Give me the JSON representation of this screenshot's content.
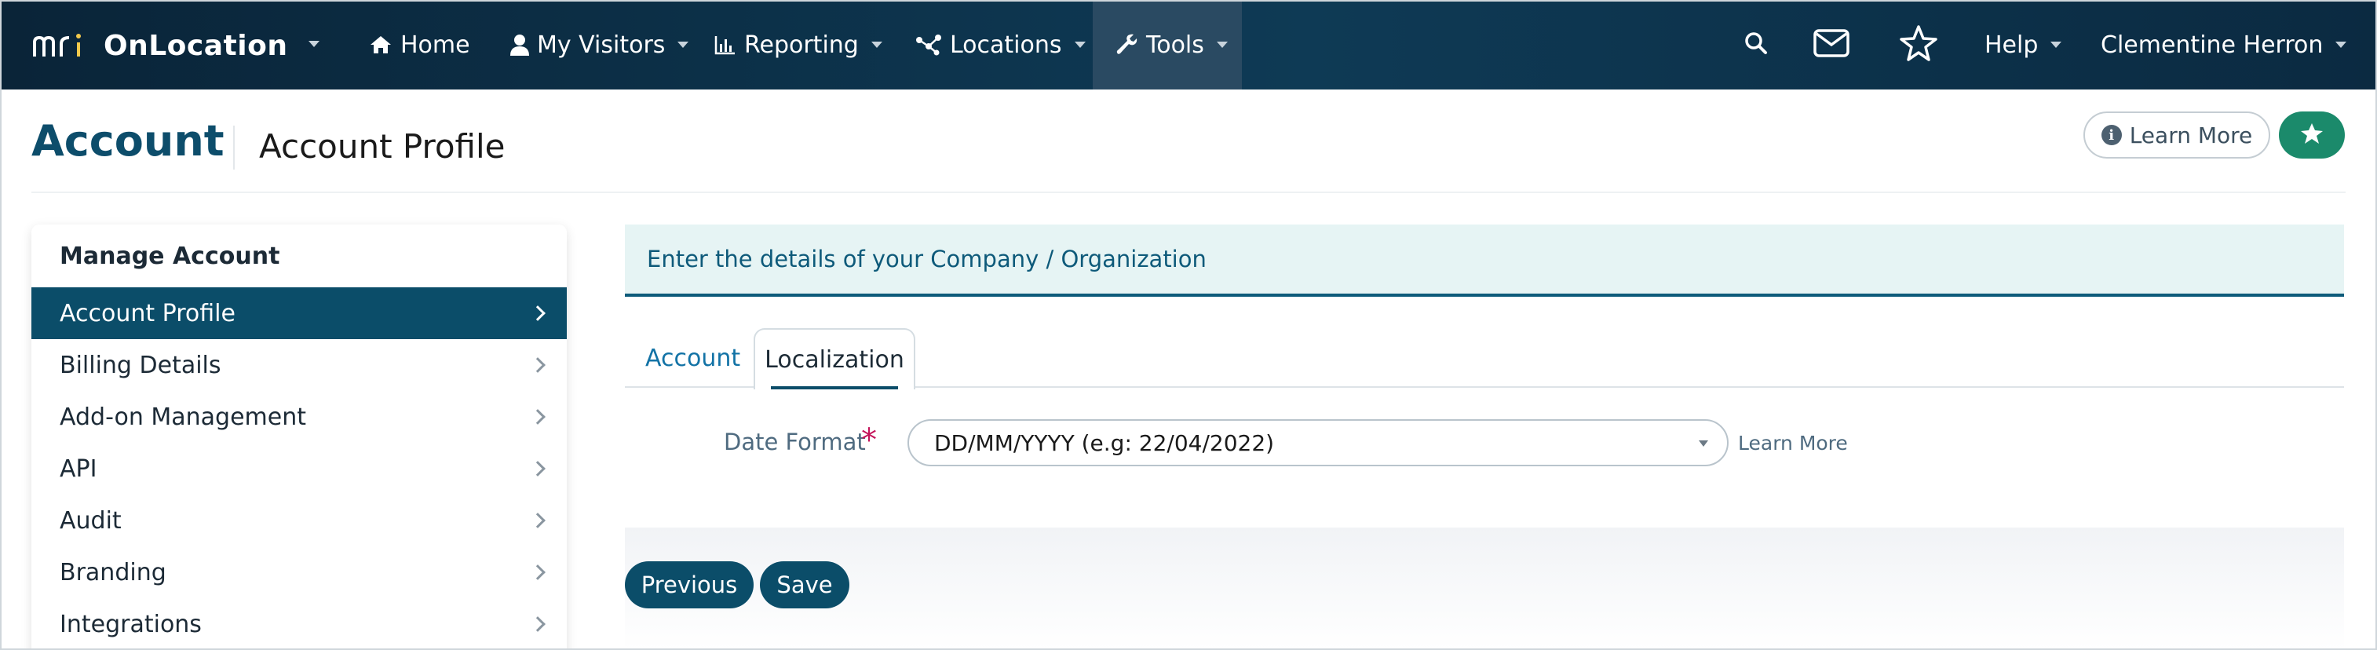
{
  "app": {
    "brand_mark": "mri",
    "brand_name": "OnLocation"
  },
  "nav": {
    "items": [
      {
        "label": "Home",
        "icon": "home-icon"
      },
      {
        "label": "My Visitors",
        "icon": "user-icon"
      },
      {
        "label": "Reporting",
        "icon": "bar-chart-icon"
      },
      {
        "label": "Locations",
        "icon": "network-icon"
      },
      {
        "label": "Tools",
        "icon": "wrench-icon"
      }
    ],
    "help_label": "Help",
    "user_name": "Clementine Herron"
  },
  "header": {
    "title": "Account",
    "subtitle": "Account Profile",
    "learn_more_label": "Learn More"
  },
  "sidebar": {
    "heading": "Manage Account",
    "items": [
      {
        "label": "Account Profile",
        "active": true
      },
      {
        "label": "Billing Details"
      },
      {
        "label": "Add-on Management"
      },
      {
        "label": "API"
      },
      {
        "label": "Audit"
      },
      {
        "label": "Branding"
      },
      {
        "label": "Integrations"
      }
    ]
  },
  "main": {
    "alert_text": "Enter the details of your Company / Organization",
    "tabs": [
      {
        "label": "Account"
      },
      {
        "label": "Localization",
        "active": true
      }
    ],
    "date_format": {
      "label": "Date Format",
      "required_mark": "*",
      "value": "DD/MM/YYYY (e.g: 22/04/2022)",
      "learn_more": "Learn More"
    },
    "buttons": {
      "previous": "Previous",
      "save": "Save"
    }
  },
  "colors": {
    "nav_bg": "#0e3a55",
    "primary": "#0b4d69",
    "accent_green": "#1b8a6b",
    "required": "#c4145a",
    "alert_bg": "#e6f4f4"
  }
}
